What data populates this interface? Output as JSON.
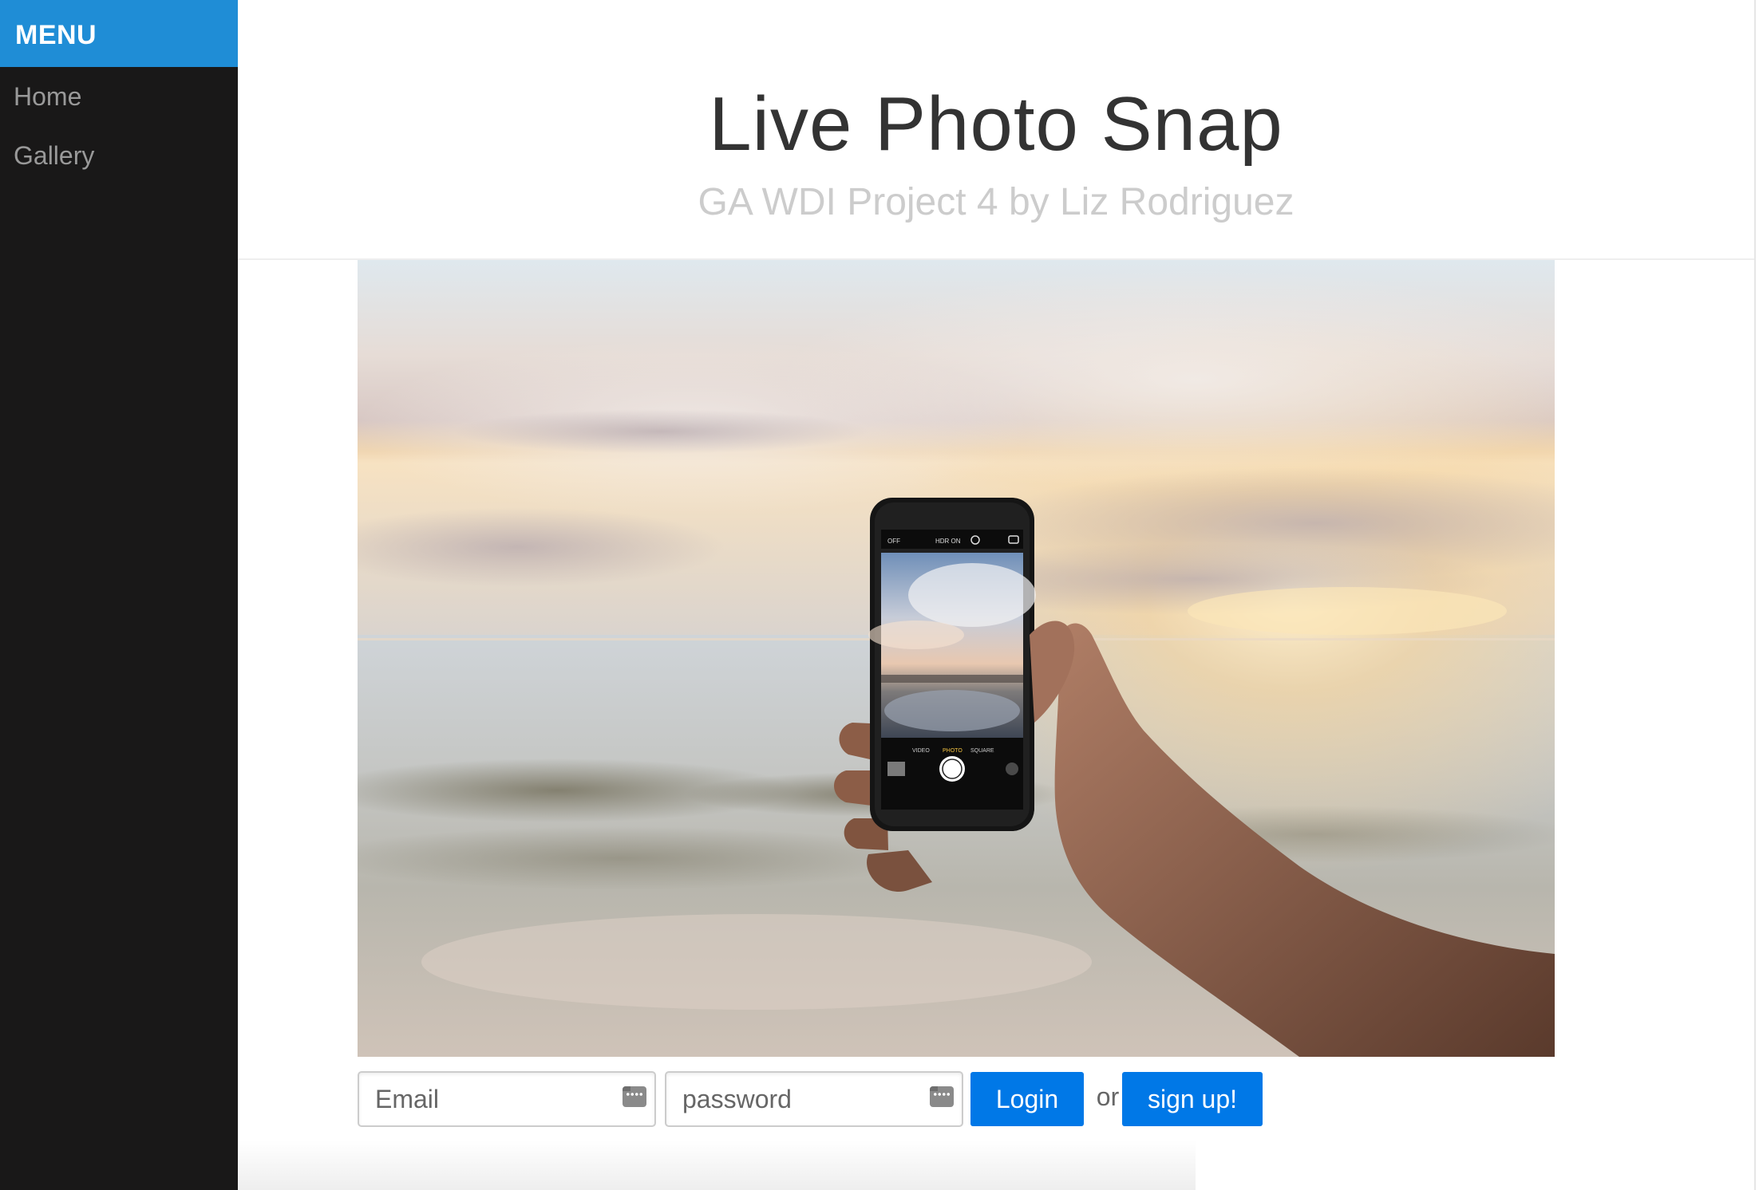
{
  "sidebar": {
    "heading": "MENU",
    "items": [
      {
        "label": "Home"
      },
      {
        "label": "Gallery"
      }
    ]
  },
  "header": {
    "title": "Live Photo Snap",
    "subtitle": "GA WDI Project 4 by Liz Rodriguez"
  },
  "hero": {
    "phone_modes": [
      "VIDEO",
      "PHOTO",
      "SQUARE"
    ],
    "phone_top_bar": [
      "OFF",
      "HDR ON"
    ]
  },
  "login": {
    "email_placeholder": "Email",
    "password_placeholder": "password",
    "login_label": "Login",
    "or_label": "or",
    "signup_label": "sign up!"
  },
  "colors": {
    "menu_accent": "#1f8dd6",
    "sidebar_bg": "#191818",
    "button": "#0078e7"
  }
}
